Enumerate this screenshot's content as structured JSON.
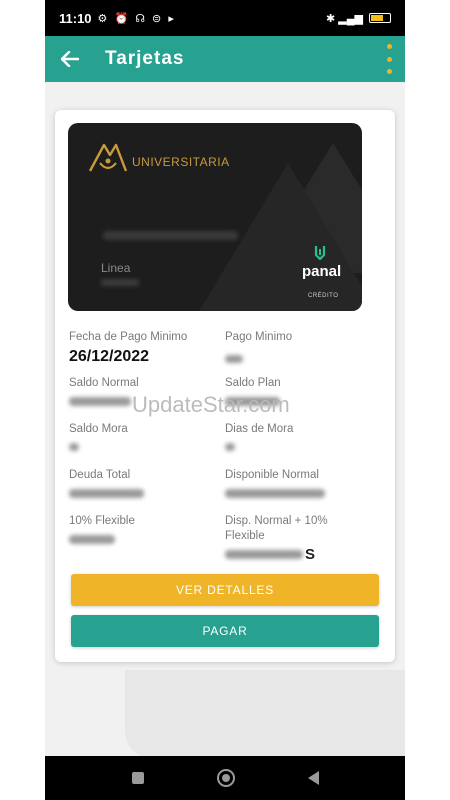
{
  "status_bar": {
    "time": "11:10",
    "icons": "⚙ ⏰ ☊ ⊜ ▸",
    "signal": "✱ ▂▄▆"
  },
  "app_bar": {
    "title": "Tarjetas",
    "back_icon": "arrow-left",
    "menu_icon": "more-vertical"
  },
  "card": {
    "brand": "UNIVERSITARIA",
    "line_label": "Linea",
    "partner": "panal",
    "type": "CRÉDITO"
  },
  "fields": {
    "fecha_pago_minimo": {
      "label": "Fecha de Pago Minimo",
      "value": "26/12/2022"
    },
    "pago_minimo": {
      "label": "Pago Minimo"
    },
    "saldo_normal": {
      "label": "Saldo Normal"
    },
    "saldo_plan": {
      "label": "Saldo Plan"
    },
    "saldo_mora": {
      "label": "Saldo Mora"
    },
    "dias_mora": {
      "label": "Dias de Mora"
    },
    "deuda_total": {
      "label": "Deuda Total"
    },
    "disponible_normal": {
      "label": "Disponible Normal"
    },
    "flexible": {
      "label": "10% Flexible"
    },
    "disp_normal_flexible": {
      "label": "Disp. Normal + 10% Flexible",
      "suffix": "S"
    }
  },
  "buttons": {
    "ver_detalles": "VER DETALLES",
    "pagar": "PAGAR"
  },
  "watermark": "UpdateStar.com",
  "colors": {
    "primary": "#27a291",
    "accent": "#f0b429",
    "card_gold": "#c89a3c"
  }
}
